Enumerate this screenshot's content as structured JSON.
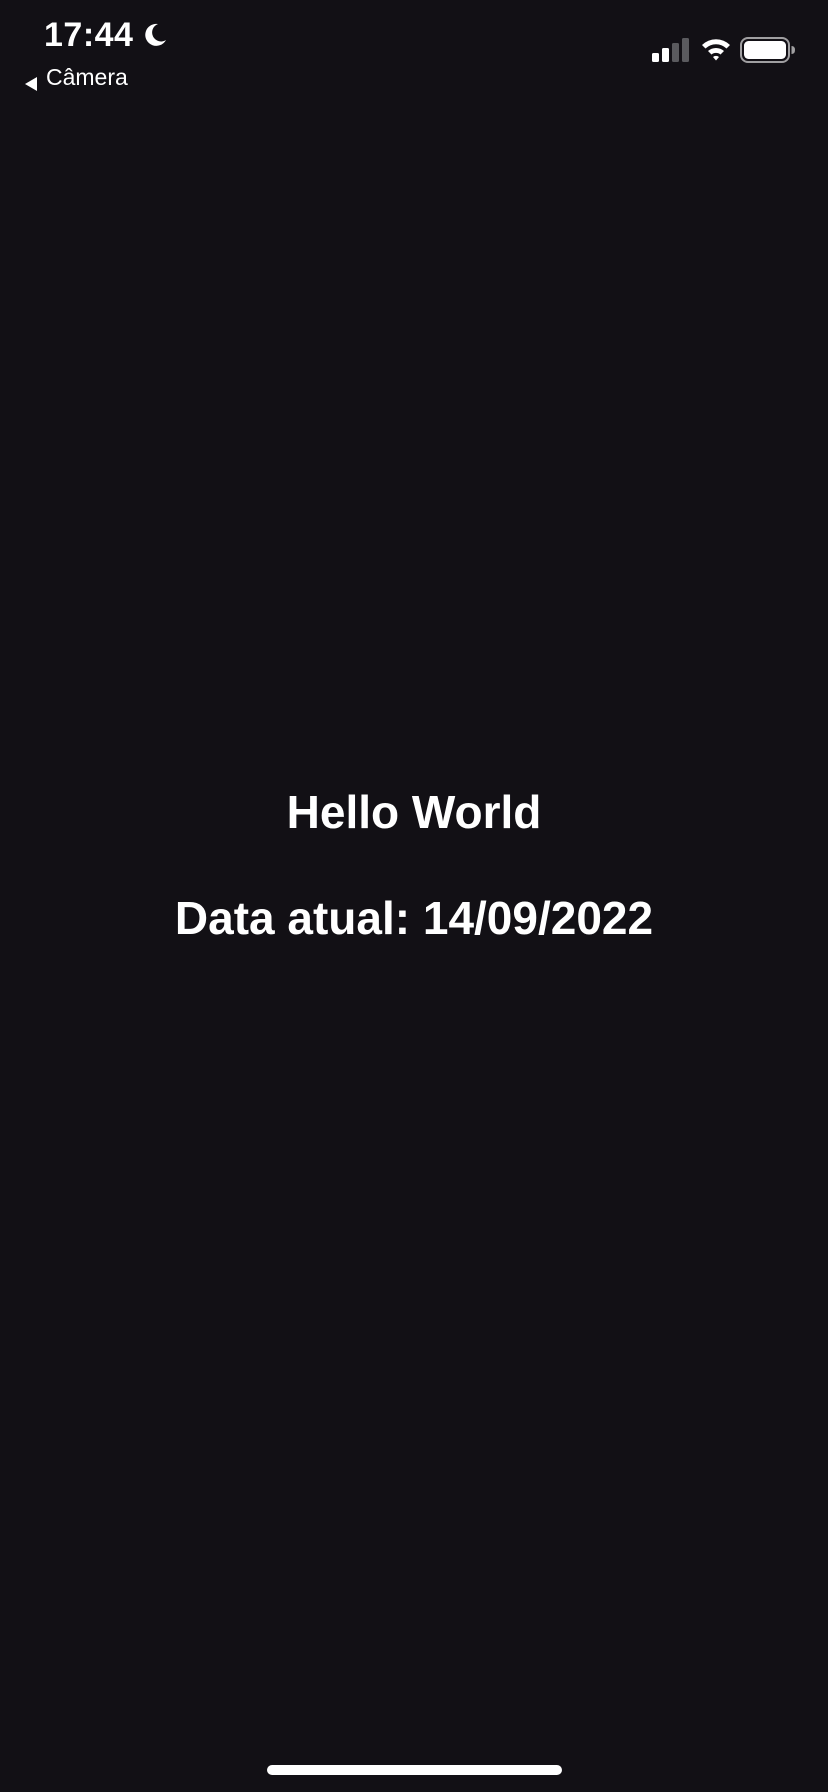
{
  "status_bar": {
    "time": "17:44",
    "back_label": "Câmera",
    "icons": {
      "focus": "moon-icon",
      "back": "back-arrow-icon",
      "signal": "cellular-signal-icon",
      "wifi": "wifi-icon",
      "battery": "battery-icon"
    }
  },
  "main": {
    "greeting": "Hello World",
    "date_label": "Data atual:",
    "date_value": "14/09/2022"
  },
  "colors": {
    "background": "#121015",
    "text": "#ffffff",
    "signal_inactive": "#5a5a5e"
  }
}
